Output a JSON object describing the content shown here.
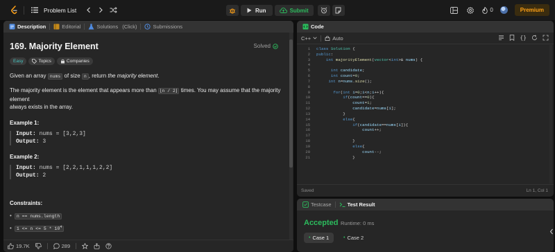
{
  "topbar": {
    "problem_list_label": "Problem List",
    "run_label": "Run",
    "submit_label": "Submit",
    "streak_count": "0",
    "premium_label": "Premium"
  },
  "description_panel": {
    "tabs": {
      "description": "Description",
      "editorial": "Editorial",
      "solutions": "Solutions",
      "click": "(Click)",
      "submissions": "Submissions"
    },
    "title": "169. Majority Element",
    "status": "Solved",
    "chips": {
      "difficulty": "Easy",
      "topics": "Topics",
      "companies": "Companies"
    },
    "intro": {
      "p1_a": "Given an array ",
      "p1_code1": "nums",
      "p1_b": " of size ",
      "p1_code2": "n",
      "p1_c": ", return ",
      "p1_em": "the majority element",
      "p1_d": ".",
      "p2_a": "The majority element is the element that appears more than ",
      "p2_code": "⌊n / 2⌋",
      "p2_b": " times. You may assume that the majority element",
      "p2_c": "always exists in the array."
    },
    "example1": {
      "heading": "Example 1:",
      "input_label": "Input:",
      "input_value": " nums = [3,2,3]",
      "output_label": "Output:",
      "output_value": " 3"
    },
    "example2": {
      "heading": "Example 2:",
      "input_label": "Input:",
      "input_value": " nums = [2,2,1,1,1,2,2]",
      "output_label": "Output:",
      "output_value": " 2"
    },
    "constraints": {
      "heading": "Constraints:",
      "c1": "n == nums.length",
      "c2": "1 <= n <= 5 * 10",
      "c2_sup": "4"
    },
    "footer": {
      "likes": "19.7K",
      "comments": "289"
    }
  },
  "code_panel": {
    "title": "Code",
    "language": "C++",
    "mode": "Auto",
    "line_numbers": [
      "1",
      "2",
      "3",
      "4",
      "5",
      "6",
      "7",
      "8",
      "9",
      "10",
      "11",
      "12",
      "13",
      "14",
      "15",
      "16",
      "17",
      "18",
      "19",
      "20",
      "21"
    ],
    "status_left": "Saved",
    "status_right": "Ln 1, Col 1"
  },
  "test_panel": {
    "testcase_tab": "Testcase",
    "result_tab": "Test Result",
    "verdict": "Accepted",
    "runtime": "Runtime: 0 ms",
    "case1": "Case 1",
    "case2": "Case 2"
  }
}
